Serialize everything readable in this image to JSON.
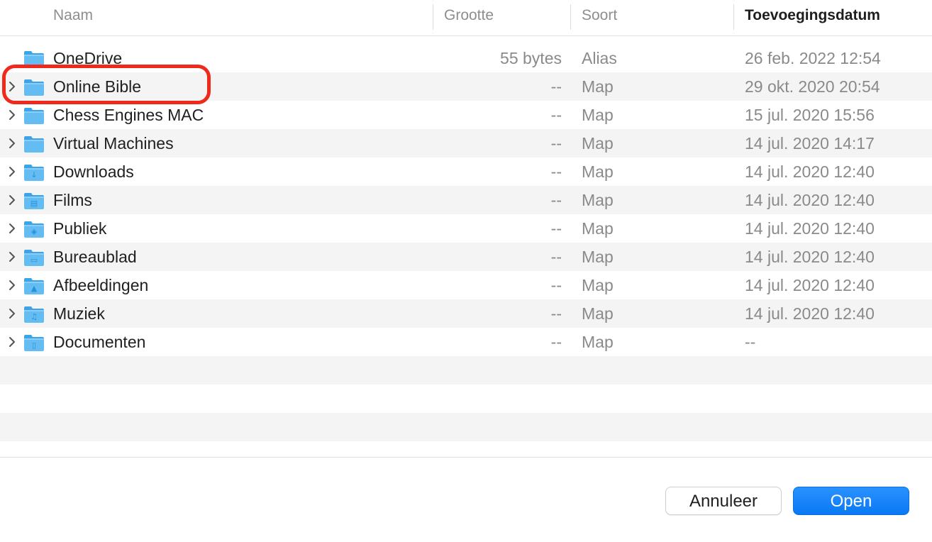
{
  "columns": {
    "name": "Naam",
    "size": "Grootte",
    "kind": "Soort",
    "date_added": "Toevoegingsdatum"
  },
  "rows": [
    {
      "name": "OneDrive",
      "size": "55 bytes",
      "kind": "Alias",
      "date": "26 feb. 2022 12:54",
      "icon": "folder-alias-icon",
      "expandable": false
    },
    {
      "name": "Online Bible",
      "size": "--",
      "kind": "Map",
      "date": "29 okt. 2020 20:54",
      "icon": "folder-icon",
      "expandable": true
    },
    {
      "name": "Chess Engines MAC",
      "size": "--",
      "kind": "Map",
      "date": "15 jul. 2020 15:56",
      "icon": "folder-icon",
      "expandable": true
    },
    {
      "name": "Virtual Machines",
      "size": "--",
      "kind": "Map",
      "date": "14 jul. 2020 14:17",
      "icon": "folder-icon",
      "expandable": true
    },
    {
      "name": "Downloads",
      "size": "--",
      "kind": "Map",
      "date": "14 jul. 2020 12:40",
      "icon": "downloads-folder-icon",
      "expandable": true
    },
    {
      "name": "Films",
      "size": "--",
      "kind": "Map",
      "date": "14 jul. 2020 12:40",
      "icon": "movies-folder-icon",
      "expandable": true
    },
    {
      "name": "Publiek",
      "size": "--",
      "kind": "Map",
      "date": "14 jul. 2020 12:40",
      "icon": "public-folder-icon",
      "expandable": true
    },
    {
      "name": "Bureaublad",
      "size": "--",
      "kind": "Map",
      "date": "14 jul. 2020 12:40",
      "icon": "desktop-folder-icon",
      "expandable": true
    },
    {
      "name": "Afbeeldingen",
      "size": "--",
      "kind": "Map",
      "date": "14 jul. 2020 12:40",
      "icon": "pictures-folder-icon",
      "expandable": true
    },
    {
      "name": "Muziek",
      "size": "--",
      "kind": "Map",
      "date": "14 jul. 2020 12:40",
      "icon": "music-folder-icon",
      "expandable": true
    },
    {
      "name": "Documenten",
      "size": "--",
      "kind": "Map",
      "date": "--",
      "icon": "documents-folder-icon",
      "expandable": true
    }
  ],
  "buttons": {
    "cancel": "Annuleer",
    "open": "Open"
  },
  "colors": {
    "accent": "#0a78f5",
    "highlight": "#ef2a1c",
    "folder": "#5bb7f0"
  }
}
